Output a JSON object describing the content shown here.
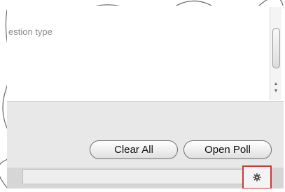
{
  "list": {
    "hint": "estion type"
  },
  "buttons": {
    "clear_all": "Clear All",
    "open_poll": "Open Poll"
  },
  "icons": {
    "gear": "gear-icon",
    "scroll_up": "arrow-up-icon",
    "scroll_down": "arrow-down-icon"
  },
  "colors": {
    "highlight_border": "#c33b3b",
    "panel_bg": "#e8e8e8"
  }
}
